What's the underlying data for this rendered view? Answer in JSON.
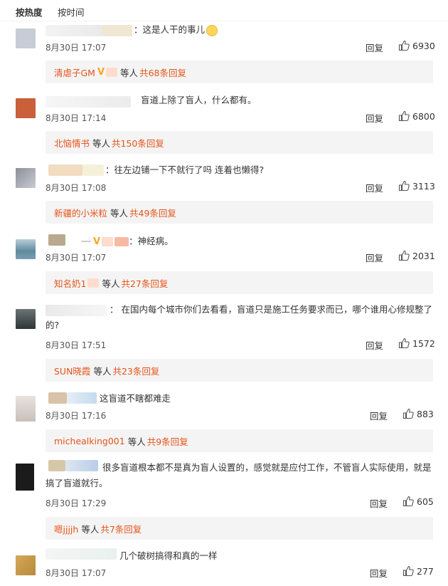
{
  "tabs": {
    "hot": "按热度",
    "time": "按时间"
  },
  "comments": [
    {
      "text": "：这是人干的事儿",
      "date": "8月30日 17:07",
      "reply": "回复",
      "likes": "6930",
      "sub_who": "清虐子GM",
      "sub_mid": "等人",
      "sub_count": "共68条回复",
      "colors": [
        "#c8ccd6",
        "#e8e0cf"
      ]
    },
    {
      "text": "盲道上除了盲人，什么都有。",
      "date": "8月30日 17:14",
      "reply": "回复",
      "likes": "6800",
      "sub_who": "北恼情书",
      "sub_mid": "等人",
      "sub_count": "共150条回复",
      "colors": [
        "#c9603a",
        "#e9e9e9"
      ]
    },
    {
      "text": "：往左边铺一下不就行了吗 连着也懒得?",
      "date": "8月30日 17:08",
      "reply": "回复",
      "likes": "3113",
      "sub_who": "新疆的小米粒",
      "sub_mid": "等人",
      "sub_count": "共49条回复",
      "colors": [
        "#8c8f9a",
        "#f2dcc2"
      ]
    },
    {
      "text": "：神经病。",
      "date": "8月30日 17:07",
      "reply": "回复",
      "likes": "2031",
      "sub_who": "知名奶1",
      "sub_mid": "等人",
      "sub_count": "共27条回复",
      "colors": [
        "#5f8a9e",
        "#b9a98f"
      ]
    },
    {
      "text": "： 在国内每个城市你们去看看，盲道只是施工任务要求而已，哪个谁用心修规整了的?",
      "date": "8月30日 17:51",
      "reply": "回复",
      "likes": "1572",
      "sub_who": "SUN晓霞",
      "sub_mid": "等人",
      "sub_count": "共23条回复",
      "colors": [
        "#2f3536",
        "#eeeeee"
      ]
    },
    {
      "text": "这盲道不瞎都难走",
      "date": "8月30日 17:16",
      "reply": "回复",
      "likes": "883",
      "sub_who": "michealking001",
      "sub_mid": "等人",
      "sub_count": "共9条回复",
      "colors": [
        "#c9c0bb",
        "#d8c3a8"
      ]
    },
    {
      "text": "很多盲道根本都不是真为盲人设置的，感觉就是应付工作，不管盲人实际使用，就是搞了盲道就行。",
      "date": "8月30日 17:29",
      "reply": "回复",
      "likes": "605",
      "sub_who": "嗯jjjjh",
      "sub_mid": "等人",
      "sub_count": "共7条回复",
      "colors": [
        "#1b1b1b",
        "#d7c7a9"
      ]
    },
    {
      "text": "几个破树搞得和真的一样",
      "date": "8月30日 17:07",
      "reply": "回复",
      "likes": "277",
      "colors": [
        "#b98a3c",
        "#eeeeee"
      ]
    }
  ]
}
